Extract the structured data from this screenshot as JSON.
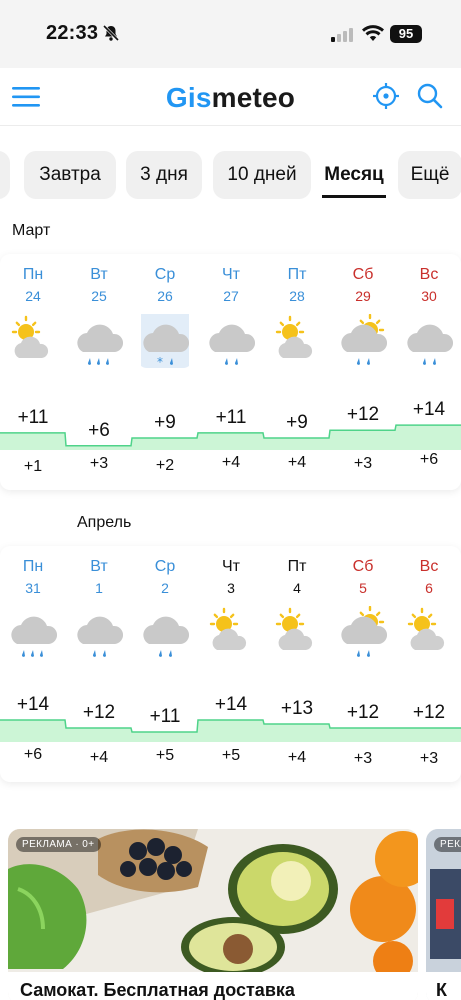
{
  "status": {
    "time": "22:33",
    "battery": "95"
  },
  "header": {
    "logo_part1": "Gis",
    "logo_part2": "meteo"
  },
  "tabs": [
    {
      "label": "Завтра"
    },
    {
      "label": "3 дня"
    },
    {
      "label": "10 дней"
    },
    {
      "label": "Месяц"
    },
    {
      "label": "Ещё"
    }
  ],
  "months": [
    {
      "label": "Март",
      "days": [
        {
          "dow": "Пн",
          "date": "24",
          "color": "blue",
          "icon": "partly-cloudy-sun-icon",
          "max": "+11",
          "min": "+1"
        },
        {
          "dow": "Вт",
          "date": "25",
          "color": "blue",
          "icon": "cloud-rain-icon",
          "max": "+6",
          "min": "+3"
        },
        {
          "dow": "Ср",
          "date": "26",
          "color": "blue",
          "icon": "cloud-rain-snow-icon",
          "max": "+9",
          "min": "+2"
        },
        {
          "dow": "Чт",
          "date": "27",
          "color": "blue",
          "icon": "cloud-light-rain-icon",
          "max": "+11",
          "min": "+4"
        },
        {
          "dow": "Пт",
          "date": "28",
          "color": "blue",
          "icon": "partly-cloudy-sun-icon",
          "max": "+9",
          "min": "+4"
        },
        {
          "dow": "Сб",
          "date": "29",
          "color": "red",
          "icon": "sun-cloud-rain-icon",
          "max": "+12",
          "min": "+3"
        },
        {
          "dow": "Вс",
          "date": "30",
          "color": "red",
          "icon": "cloud-light-rain-icon",
          "max": "+14",
          "min": "+6"
        }
      ]
    },
    {
      "label": "Апрель",
      "days": [
        {
          "dow": "Пн",
          "date": "31",
          "color": "blue",
          "icon": "cloud-rain-icon",
          "max": "+14",
          "min": "+6"
        },
        {
          "dow": "Вт",
          "date": "1",
          "color": "blue",
          "icon": "cloud-light-rain-icon",
          "max": "+12",
          "min": "+4"
        },
        {
          "dow": "Ср",
          "date": "2",
          "color": "blue",
          "icon": "cloud-light-rain-icon",
          "max": "+11",
          "min": "+5"
        },
        {
          "dow": "Чт",
          "date": "3",
          "color": "dark",
          "icon": "partly-cloudy-sun-icon",
          "max": "+14",
          "min": "+5"
        },
        {
          "dow": "Пт",
          "date": "4",
          "color": "dark",
          "icon": "partly-cloudy-sun-icon",
          "max": "+13",
          "min": "+4"
        },
        {
          "dow": "Сб",
          "date": "5",
          "color": "red",
          "icon": "sun-cloud-rain-icon",
          "max": "+12",
          "min": "+3"
        },
        {
          "dow": "Вс",
          "date": "6",
          "color": "red",
          "icon": "partly-cloudy-sun-icon",
          "max": "+12",
          "min": "+3"
        }
      ]
    }
  ],
  "ad": {
    "badge": "РЕКЛАМА · 0+",
    "title": "Самокат. Бесплатная доставка",
    "badge2": "РЕКЛ",
    "title2": "К"
  },
  "colors": {
    "accent": "#2196F3",
    "band_fill": "#ccf5d6",
    "band_line": "#4fd38a",
    "weekend": "#c9302c",
    "weekday": "#3a8fd8"
  }
}
